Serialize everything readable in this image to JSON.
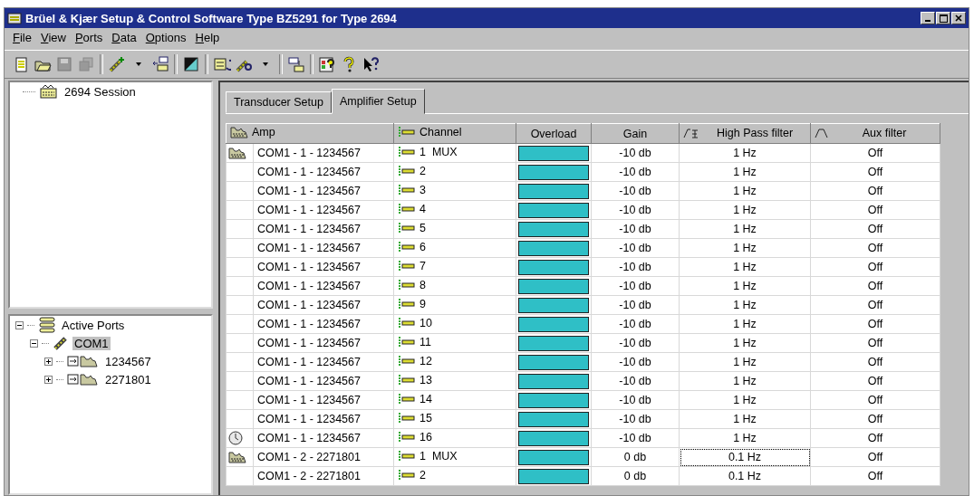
{
  "window": {
    "title": "Brüel & Kjær Setup & Control Software Type BZ5291 for Type 2694"
  },
  "menu": [
    "File",
    "View",
    "Ports",
    "Data",
    "Options",
    "Help"
  ],
  "session": {
    "label": "2694 Session"
  },
  "ports": [
    {
      "label": "Active Ports",
      "kind": "ports",
      "expanded": true,
      "selected": false,
      "children": [
        {
          "label": "COM1",
          "kind": "port",
          "expanded": true,
          "selected": true,
          "children": [
            {
              "label": "1234567",
              "kind": "amp",
              "expanded": false,
              "selected": false
            },
            {
              "label": "2271801",
              "kind": "amp",
              "expanded": false,
              "selected": false
            }
          ]
        }
      ]
    }
  ],
  "tabs": [
    {
      "label": "Transducer Setup",
      "selected": false
    },
    {
      "label": "Amplifier Setup",
      "selected": true
    }
  ],
  "columns": [
    "Amp",
    "Channel",
    "Overload",
    "Gain",
    "High Pass filter",
    "Aux filter"
  ],
  "rows": [
    {
      "kind": "amp",
      "amp": "COM1 - 1 - 1234567",
      "channel": "1  MUX",
      "gain": "-10 db",
      "hpf": "1 Hz",
      "aux": "Off",
      "focused": false
    },
    {
      "kind": "none",
      "amp": "COM1 - 1 - 1234567",
      "channel": "2",
      "gain": "-10 db",
      "hpf": "1 Hz",
      "aux": "Off",
      "focused": false
    },
    {
      "kind": "none",
      "amp": "COM1 - 1 - 1234567",
      "channel": "3",
      "gain": "-10 db",
      "hpf": "1 Hz",
      "aux": "Off",
      "focused": false
    },
    {
      "kind": "none",
      "amp": "COM1 - 1 - 1234567",
      "channel": "4",
      "gain": "-10 db",
      "hpf": "1 Hz",
      "aux": "Off",
      "focused": false
    },
    {
      "kind": "none",
      "amp": "COM1 - 1 - 1234567",
      "channel": "5",
      "gain": "-10 db",
      "hpf": "1 Hz",
      "aux": "Off",
      "focused": false
    },
    {
      "kind": "none",
      "amp": "COM1 - 1 - 1234567",
      "channel": "6",
      "gain": "-10 db",
      "hpf": "1 Hz",
      "aux": "Off",
      "focused": false
    },
    {
      "kind": "none",
      "amp": "COM1 - 1 - 1234567",
      "channel": "7",
      "gain": "-10 db",
      "hpf": "1 Hz",
      "aux": "Off",
      "focused": false
    },
    {
      "kind": "none",
      "amp": "COM1 - 1 - 1234567",
      "channel": "8",
      "gain": "-10 db",
      "hpf": "1 Hz",
      "aux": "Off",
      "focused": false
    },
    {
      "kind": "none",
      "amp": "COM1 - 1 - 1234567",
      "channel": "9",
      "gain": "-10 db",
      "hpf": "1 Hz",
      "aux": "Off",
      "focused": false
    },
    {
      "kind": "none",
      "amp": "COM1 - 1 - 1234567",
      "channel": "10",
      "gain": "-10 db",
      "hpf": "1 Hz",
      "aux": "Off",
      "focused": false
    },
    {
      "kind": "none",
      "amp": "COM1 - 1 - 1234567",
      "channel": "11",
      "gain": "-10 db",
      "hpf": "1 Hz",
      "aux": "Off",
      "focused": false
    },
    {
      "kind": "none",
      "amp": "COM1 - 1 - 1234567",
      "channel": "12",
      "gain": "-10 db",
      "hpf": "1 Hz",
      "aux": "Off",
      "focused": false
    },
    {
      "kind": "none",
      "amp": "COM1 - 1 - 1234567",
      "channel": "13",
      "gain": "-10 db",
      "hpf": "1 Hz",
      "aux": "Off",
      "focused": false
    },
    {
      "kind": "none",
      "amp": "COM1 - 1 - 1234567",
      "channel": "14",
      "gain": "-10 db",
      "hpf": "1 Hz",
      "aux": "Off",
      "focused": false
    },
    {
      "kind": "none",
      "amp": "COM1 - 1 - 1234567",
      "channel": "15",
      "gain": "-10 db",
      "hpf": "1 Hz",
      "aux": "Off",
      "focused": false
    },
    {
      "kind": "clock",
      "amp": "COM1 - 1 - 1234567",
      "channel": "16",
      "gain": "-10 db",
      "hpf": "1 Hz",
      "aux": "Off",
      "focused": false
    },
    {
      "kind": "amp",
      "amp": "COM1 - 2 - 2271801",
      "channel": "1  MUX",
      "gain": "0 db",
      "hpf": "0.1 Hz",
      "aux": "Off",
      "focused": true
    },
    {
      "kind": "none",
      "amp": "COM1 - 2 - 2271801",
      "channel": "2",
      "gain": "0 db",
      "hpf": "0.1 Hz",
      "aux": "Off",
      "focused": false
    }
  ]
}
